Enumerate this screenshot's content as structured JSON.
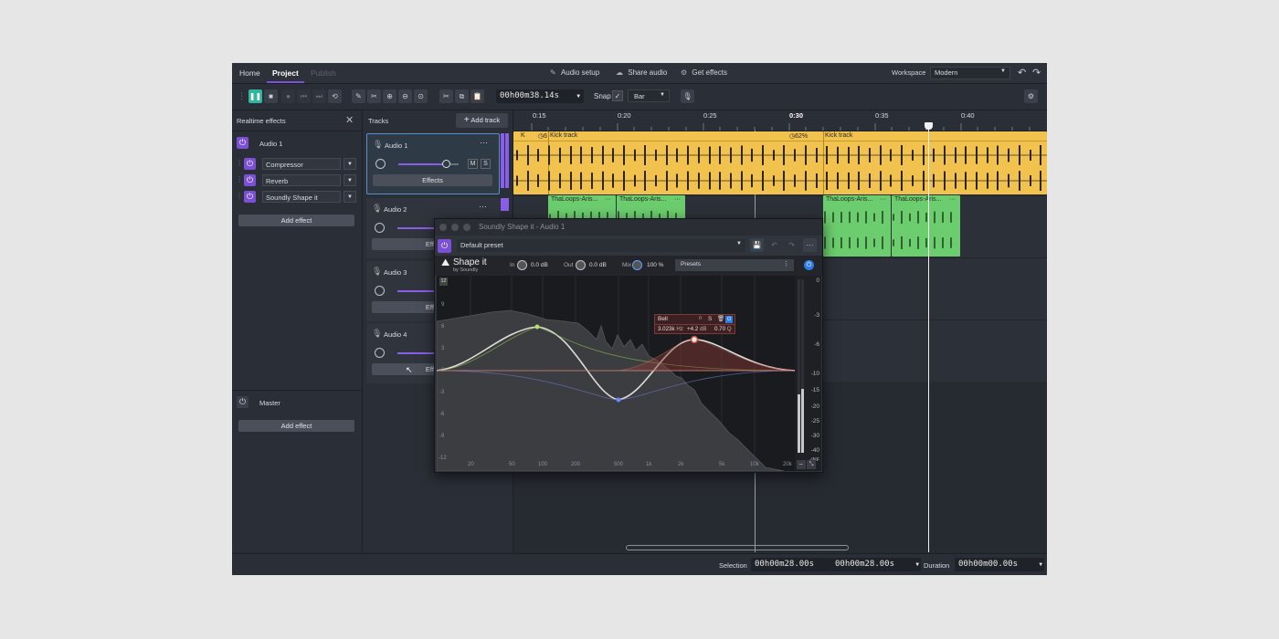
{
  "nav": {
    "tabs": [
      "Home",
      "Project",
      "Publish"
    ],
    "active": "Project"
  },
  "menu": {
    "audio_setup": "Audio setup",
    "share_audio": "Share audio",
    "get_effects": "Get effects",
    "workspace_label": "Workspace",
    "workspace_value": "Modern"
  },
  "toolbar": {
    "time": "00h00m38.14s",
    "snap_label": "Snap",
    "snap_value": "Bar"
  },
  "left_panel": {
    "title": "Realtime effects",
    "track_name": "Audio 1",
    "effects": [
      "Compressor",
      "Reverb",
      "Soundly Shape it"
    ],
    "add_effect": "Add effect",
    "master": "Master",
    "master_add_effect": "Add effect"
  },
  "tracks_panel": {
    "title": "Tracks",
    "add_track": "Add track",
    "tracks": [
      {
        "name": "Audio 1",
        "effects_label": "Effects",
        "mute": "M",
        "solo": "S"
      },
      {
        "name": "Audio 2",
        "effects_label": "Effe"
      },
      {
        "name": "Audio 3",
        "effects_label": "Effe"
      },
      {
        "name": "Audio 4",
        "effects_label": "Effe"
      }
    ]
  },
  "ruler": {
    "ticks": [
      "0:15",
      "0:20",
      "0:25",
      "0:30",
      "0:35",
      "0:40"
    ],
    "bold": "0:30"
  },
  "clips": {
    "kick_a_short": "K",
    "kick_a_badge": "6",
    "kick_a": "Kick track",
    "kick_b_badge": "62%",
    "kick_b": "Kick track",
    "loop_labels": [
      "ThaLoops-Aris...",
      "ThaLoops-Aris...",
      "ThaLoops-Aris...",
      "ThaLoops-Aris..."
    ],
    "more": "···"
  },
  "plugin": {
    "title": "Soundly Shape it - Audio 1",
    "preset": "Default preset",
    "brand": "Shape it",
    "brand_sub": "by Soundly",
    "in_label": "In",
    "in_value": "0.0 dB",
    "out_label": "Out",
    "out_value": "0.0 dB",
    "mix_label": "Mix",
    "mix_value": "100 %",
    "presets": "Presets",
    "band": {
      "type": "Bell",
      "freq": "3.023k",
      "freq_unit": "Hz",
      "gain": "+4.2",
      "gain_unit": "dB",
      "q": "0.70",
      "q_unit": "Q",
      "solo": "S"
    },
    "db_scale": [
      "12",
      "9",
      "6",
      "3",
      "0",
      "-3",
      "-6",
      "-9",
      "-12"
    ],
    "freq_scale": [
      "20",
      "50",
      "100",
      "200",
      "500",
      "1k",
      "2k",
      "5k",
      "10k",
      "20k"
    ],
    "meter_scale": [
      "0",
      "-3",
      "-6",
      "-10",
      "-15",
      "-20",
      "-25",
      "-30",
      "-40",
      "-INF"
    ]
  },
  "bottom": {
    "selection_label": "Selection",
    "sel_start": "00h00m28.00s",
    "sel_end": "00h00m28.00s",
    "duration_label": "Duration",
    "duration": "00h00m00.00s"
  },
  "colors": {
    "accent": "#7b4fd6",
    "kick_clip": "#f2c24e",
    "loop_clip": "#6ccd6e",
    "selection_blue": "#5b8fc7"
  }
}
